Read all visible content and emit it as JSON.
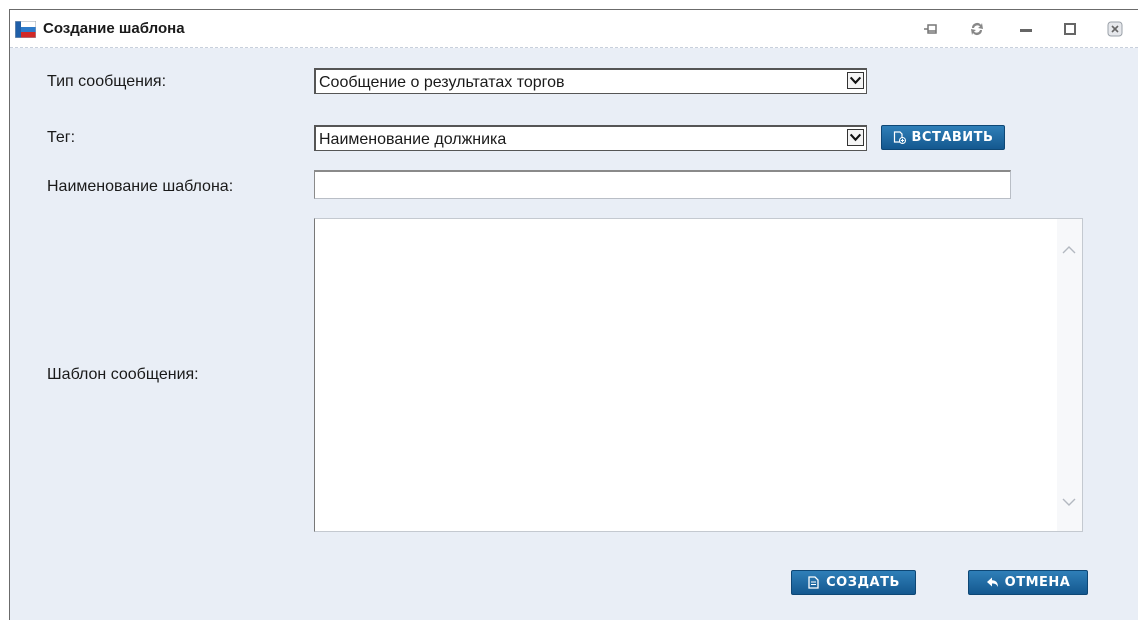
{
  "window": {
    "title": "Создание шаблона"
  },
  "form": {
    "message_type": {
      "label": "Тип сообщения:",
      "value": "Сообщение о результатах торгов"
    },
    "tag": {
      "label": "Тег:",
      "value": "Наименование должника",
      "insert_label": "ВСТАВИТЬ"
    },
    "template_name": {
      "label": "Наименование шаблона:",
      "value": ""
    },
    "template_body": {
      "label": "Шаблон сообщения:",
      "value": ""
    }
  },
  "actions": {
    "create_label": "СОЗДАТЬ",
    "cancel_label": "ОТМЕНА"
  },
  "colors": {
    "button": "#1b6aa5",
    "panel_bg": "#e9eef6"
  }
}
